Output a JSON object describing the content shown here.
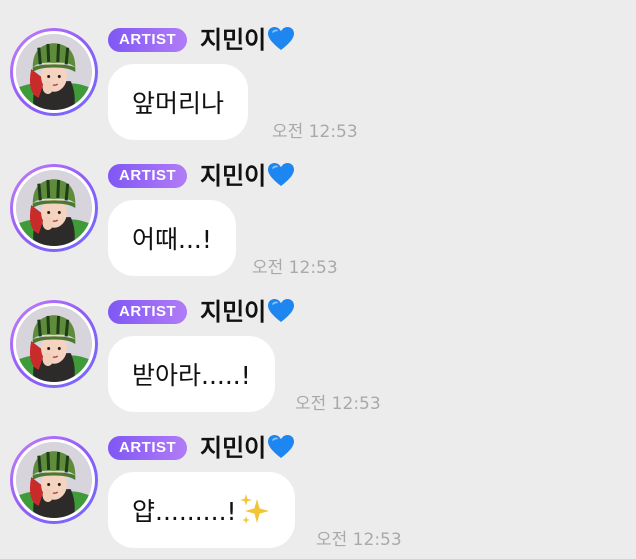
{
  "messages": [
    {
      "badge": "ARTIST",
      "sender": "지민이",
      "text": "앞머리나",
      "time": "오전 12:53"
    },
    {
      "badge": "ARTIST",
      "sender": "지민이",
      "text": "어때...!",
      "time": "오전 12:53"
    },
    {
      "badge": "ARTIST",
      "sender": "지민이",
      "text": "받아라.....!",
      "time": "오전 12:53"
    },
    {
      "badge": "ARTIST",
      "sender": "지민이",
      "text": "얍.........!",
      "time": "오전 12:53"
    }
  ],
  "icons": {
    "sender_suffix": "blue-heart-icon",
    "last_message_suffix": "sparkles-icon"
  },
  "colors": {
    "background": "#ececec",
    "bubble": "#ffffff",
    "badge_start": "#7f57f5",
    "badge_end": "#b27cf6",
    "avatar_ring": "#8f5cf7",
    "heart": "#1e86f0",
    "sparkle": "#f3c535",
    "timestamp": "#a9a9a9"
  }
}
